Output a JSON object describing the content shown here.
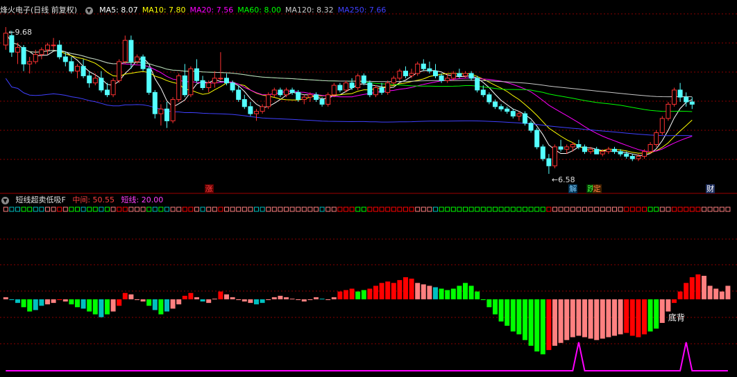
{
  "title": "烽火电子(日线 前复权)",
  "ma": [
    {
      "label": "MA5: 8.07",
      "color": "#ffffff"
    },
    {
      "label": "MA10: 7.80",
      "color": "#ffff00"
    },
    {
      "label": "MA20: 7.56",
      "color": "#ff00ff"
    },
    {
      "label": "MA60: 8.00",
      "color": "#00ff00"
    },
    {
      "label": "MA120: 8.32",
      "color": "#c8c8c8"
    },
    {
      "label": "MA250: 7.66",
      "color": "#4040ff"
    }
  ],
  "price_high_label": "9.68",
  "price_low_label": "6.58",
  "event_tags": [
    {
      "text": "涨",
      "color": "#ff4040",
      "bg": "#600000",
      "index": 34
    },
    {
      "text": "解",
      "color": "#80d0ff",
      "bg": "#003050",
      "index": 95
    },
    {
      "text": "跌",
      "color": "#40ff40",
      "bg": "#003000",
      "index": 98
    },
    {
      "text": "定",
      "color": "#ff8040",
      "bg": "#402000",
      "index": 99
    },
    {
      "text": "财",
      "color": "#ffffff",
      "bg": "#203060",
      "index": 118
    }
  ],
  "indicator": {
    "name": "短线超卖低吸F",
    "mid_label": "中间: 50.55",
    "mid_color": "#ff4040",
    "short_label": "短线: 20.00",
    "short_color": "#ff40ff",
    "annotation": "底背"
  },
  "colors": {
    "up": "#ff3232",
    "down": "#54ffff",
    "grid": "#8b0000",
    "bar_red": "#ff0000",
    "bar_pink": "#ff8080",
    "bar_green": "#00ff00",
    "bar_cyan": "#00c0c0",
    "spike": "#ff00ff"
  },
  "chart_data": [
    {
      "type": "candlestick",
      "title": "烽火电子(日线 前复权)",
      "ylim": [
        6.3,
        9.9
      ],
      "ohlc": [
        [
          9.3,
          9.68,
          9.2,
          9.55
        ],
        [
          9.5,
          9.6,
          9.05,
          9.15
        ],
        [
          9.15,
          9.35,
          8.9,
          9.25
        ],
        [
          9.25,
          9.3,
          8.75,
          8.9
        ],
        [
          8.9,
          9.05,
          8.7,
          8.95
        ],
        [
          8.95,
          9.2,
          8.9,
          9.1
        ],
        [
          9.1,
          9.25,
          9.0,
          9.2
        ],
        [
          9.2,
          9.35,
          9.1,
          9.3
        ],
        [
          9.3,
          9.45,
          9.2,
          9.3
        ],
        [
          9.3,
          9.4,
          9.0,
          9.05
        ],
        [
          9.05,
          9.15,
          8.85,
          8.95
        ],
        [
          8.95,
          9.05,
          8.7,
          8.75
        ],
        [
          8.75,
          8.9,
          8.6,
          8.85
        ],
        [
          8.85,
          9.0,
          8.6,
          8.65
        ],
        [
          8.65,
          8.75,
          8.4,
          8.5
        ],
        [
          8.5,
          8.7,
          8.45,
          8.6
        ],
        [
          8.6,
          8.75,
          8.3,
          8.35
        ],
        [
          8.35,
          8.5,
          8.2,
          8.25
        ],
        [
          8.25,
          8.6,
          8.2,
          8.55
        ],
        [
          8.55,
          9.0,
          8.5,
          8.95
        ],
        [
          8.95,
          9.5,
          8.9,
          9.4
        ],
        [
          9.4,
          9.5,
          8.8,
          8.95
        ],
        [
          8.95,
          9.1,
          8.9,
          9.05
        ],
        [
          9.05,
          9.1,
          8.75,
          8.8
        ],
        [
          8.8,
          8.85,
          8.25,
          8.3
        ],
        [
          8.3,
          8.35,
          7.75,
          7.85
        ],
        [
          7.85,
          8.05,
          7.6,
          7.95
        ],
        [
          7.95,
          8.1,
          7.55,
          7.7
        ],
        [
          7.7,
          8.2,
          7.65,
          8.15
        ],
        [
          8.15,
          8.7,
          8.1,
          8.65
        ],
        [
          8.65,
          8.9,
          8.2,
          8.25
        ],
        [
          8.25,
          8.85,
          8.2,
          8.8
        ],
        [
          8.8,
          9.0,
          8.5,
          8.55
        ],
        [
          8.55,
          8.65,
          8.35,
          8.4
        ],
        [
          8.4,
          8.55,
          8.3,
          8.5
        ],
        [
          8.5,
          8.75,
          8.4,
          8.6
        ],
        [
          8.6,
          9.15,
          8.55,
          8.6
        ],
        [
          8.6,
          8.7,
          8.45,
          8.5
        ],
        [
          8.5,
          8.55,
          8.3,
          8.35
        ],
        [
          8.35,
          8.45,
          8.1,
          8.15
        ],
        [
          8.15,
          8.25,
          7.95,
          8.0
        ],
        [
          8.0,
          8.1,
          7.8,
          7.85
        ],
        [
          7.85,
          7.95,
          7.7,
          7.9
        ],
        [
          7.9,
          8.05,
          7.85,
          8.0
        ],
        [
          8.0,
          8.3,
          7.95,
          8.25
        ],
        [
          8.25,
          8.4,
          8.2,
          8.35
        ],
        [
          8.35,
          8.4,
          8.2,
          8.25
        ],
        [
          8.25,
          8.4,
          8.2,
          8.35
        ],
        [
          8.35,
          8.4,
          8.25,
          8.3
        ],
        [
          8.3,
          8.35,
          8.1,
          8.15
        ],
        [
          8.15,
          8.25,
          8.05,
          8.2
        ],
        [
          8.2,
          8.3,
          8.1,
          8.25
        ],
        [
          8.25,
          8.3,
          8.1,
          8.15
        ],
        [
          8.15,
          8.2,
          8.0,
          8.05
        ],
        [
          8.05,
          8.3,
          8.0,
          8.25
        ],
        [
          8.25,
          8.5,
          8.2,
          8.45
        ],
        [
          8.45,
          8.5,
          8.3,
          8.35
        ],
        [
          8.35,
          8.55,
          8.3,
          8.5
        ],
        [
          8.5,
          8.6,
          8.35,
          8.4
        ],
        [
          8.4,
          8.7,
          8.35,
          8.65
        ],
        [
          8.65,
          8.7,
          8.45,
          8.5
        ],
        [
          8.5,
          8.55,
          8.2,
          8.25
        ],
        [
          8.25,
          8.45,
          8.2,
          8.4
        ],
        [
          8.4,
          8.5,
          8.25,
          8.3
        ],
        [
          8.3,
          8.55,
          8.25,
          8.5
        ],
        [
          8.5,
          8.65,
          8.45,
          8.6
        ],
        [
          8.6,
          8.8,
          8.55,
          8.75
        ],
        [
          8.75,
          8.85,
          8.6,
          8.65
        ],
        [
          8.65,
          8.8,
          8.6,
          8.7
        ],
        [
          8.7,
          8.95,
          8.65,
          8.9
        ],
        [
          8.9,
          9.0,
          8.75,
          8.8
        ],
        [
          8.8,
          8.95,
          8.7,
          8.75
        ],
        [
          8.75,
          8.9,
          8.6,
          8.65
        ],
        [
          8.65,
          8.7,
          8.5,
          8.55
        ],
        [
          8.55,
          8.7,
          8.5,
          8.6
        ],
        [
          8.6,
          8.75,
          8.55,
          8.7
        ],
        [
          8.7,
          8.8,
          8.6,
          8.65
        ],
        [
          8.65,
          8.75,
          8.6,
          8.7
        ],
        [
          8.7,
          8.75,
          8.55,
          8.6
        ],
        [
          8.6,
          8.65,
          8.3,
          8.35
        ],
        [
          8.35,
          8.45,
          8.2,
          8.25
        ],
        [
          8.25,
          8.3,
          8.05,
          8.1
        ],
        [
          8.1,
          8.15,
          7.95,
          8.0
        ],
        [
          8.0,
          8.05,
          7.9,
          7.95
        ],
        [
          7.95,
          8.0,
          7.85,
          7.9
        ],
        [
          7.9,
          7.95,
          7.75,
          7.8
        ],
        [
          7.8,
          7.9,
          7.7,
          7.85
        ],
        [
          7.85,
          7.9,
          7.6,
          7.65
        ],
        [
          7.65,
          7.7,
          7.45,
          7.5
        ],
        [
          7.5,
          7.55,
          7.1,
          7.15
        ],
        [
          7.15,
          7.2,
          6.85,
          6.9
        ],
        [
          6.9,
          7.0,
          6.58,
          6.75
        ],
        [
          6.75,
          7.2,
          6.7,
          7.15
        ],
        [
          7.15,
          7.3,
          7.05,
          7.1
        ],
        [
          7.1,
          7.2,
          7.0,
          7.15
        ],
        [
          7.15,
          7.25,
          7.05,
          7.2
        ],
        [
          7.2,
          7.3,
          7.1,
          7.15
        ],
        [
          7.15,
          7.2,
          7.0,
          7.05
        ],
        [
          7.05,
          7.15,
          7.0,
          7.1
        ],
        [
          7.1,
          7.15,
          7.0,
          7.0
        ],
        [
          7.0,
          7.1,
          6.95,
          7.05
        ],
        [
          7.05,
          7.15,
          7.0,
          7.1
        ],
        [
          7.1,
          7.15,
          7.0,
          7.05
        ],
        [
          7.05,
          7.1,
          6.95,
          7.0
        ],
        [
          7.0,
          7.05,
          6.9,
          6.95
        ],
        [
          6.95,
          7.0,
          6.85,
          6.9
        ],
        [
          6.9,
          7.0,
          6.85,
          6.95
        ],
        [
          6.95,
          7.1,
          6.9,
          7.05
        ],
        [
          7.05,
          7.25,
          7.0,
          7.2
        ],
        [
          7.2,
          7.5,
          7.15,
          7.45
        ],
        [
          7.45,
          7.8,
          7.4,
          7.75
        ],
        [
          7.75,
          8.1,
          7.7,
          8.05
        ],
        [
          8.05,
          8.4,
          8.0,
          8.35
        ],
        [
          8.35,
          8.5,
          8.1,
          8.2
        ],
        [
          8.2,
          8.3,
          8.0,
          8.1
        ],
        [
          8.1,
          8.2,
          7.95,
          8.05
        ]
      ]
    },
    {
      "type": "bar",
      "title": "短线超卖低吸F",
      "ylim": [
        0,
        100
      ],
      "baseline": 50.55,
      "values": [
        52,
        50,
        48,
        45,
        42,
        43,
        46,
        47,
        48,
        50,
        49,
        47,
        45,
        44,
        42,
        40,
        38,
        40,
        42,
        46,
        55,
        54,
        50,
        49,
        46,
        43,
        40,
        42,
        44,
        47,
        53,
        55,
        52,
        49,
        48,
        51,
        56,
        54,
        52,
        50,
        49,
        48,
        47,
        48,
        50,
        52,
        53,
        52,
        51,
        50,
        49,
        50,
        52,
        51,
        50,
        52,
        56,
        57,
        58,
        56,
        57,
        58,
        60,
        62,
        63,
        62,
        64,
        66,
        65,
        62,
        61,
        60,
        59,
        58,
        57,
        58,
        60,
        62,
        60,
        56,
        50,
        45,
        40,
        35,
        32,
        28,
        26,
        22,
        18,
        14,
        12,
        15,
        18,
        20,
        22,
        24,
        25,
        24,
        23,
        22,
        23,
        24,
        25,
        26,
        27,
        25,
        24,
        26,
        28,
        30,
        34,
        42,
        48,
        56,
        62,
        66,
        68,
        67,
        60,
        58,
        56,
        60
      ],
      "colors": [
        "pink",
        "cyan",
        "cyan",
        "green",
        "green",
        "cyan",
        "cyan",
        "pink",
        "pink",
        "red",
        "pink",
        "green",
        "green",
        "cyan",
        "green",
        "green",
        "cyan",
        "green",
        "pink",
        "red",
        "red",
        "pink",
        "pink",
        "pink",
        "green",
        "cyan",
        "green",
        "cyan",
        "pink",
        "pink",
        "red",
        "red",
        "pink",
        "cyan",
        "pink",
        "pink",
        "red",
        "pink",
        "pink",
        "pink",
        "pink",
        "pink",
        "cyan",
        "cyan",
        "pink",
        "pink",
        "pink",
        "pink",
        "pink",
        "pink",
        "pink",
        "pink",
        "pink",
        "cyan",
        "pink",
        "pink",
        "red",
        "red",
        "red",
        "green",
        "green",
        "red",
        "red",
        "red",
        "red",
        "red",
        "red",
        "red",
        "red",
        "pink",
        "pink",
        "pink",
        "cyan",
        "green",
        "green",
        "green",
        "green",
        "green",
        "green",
        "green",
        "green",
        "green",
        "green",
        "green",
        "green",
        "green",
        "green",
        "green",
        "green",
        "green",
        "green",
        "red",
        "pink",
        "pink",
        "pink",
        "pink",
        "pink",
        "pink",
        "pink",
        "pink",
        "pink",
        "pink",
        "pink",
        "pink",
        "red",
        "red",
        "red",
        "red",
        "green",
        "green",
        "pink",
        "pink",
        "red",
        "red",
        "red",
        "red",
        "red",
        "pink",
        "pink",
        "pink",
        "pink",
        "pink"
      ],
      "spike_line": {
        "baseline": 0,
        "peaks": [
          {
            "index": 96,
            "value": 20
          },
          {
            "index": 114,
            "value": 20
          }
        ]
      }
    }
  ]
}
